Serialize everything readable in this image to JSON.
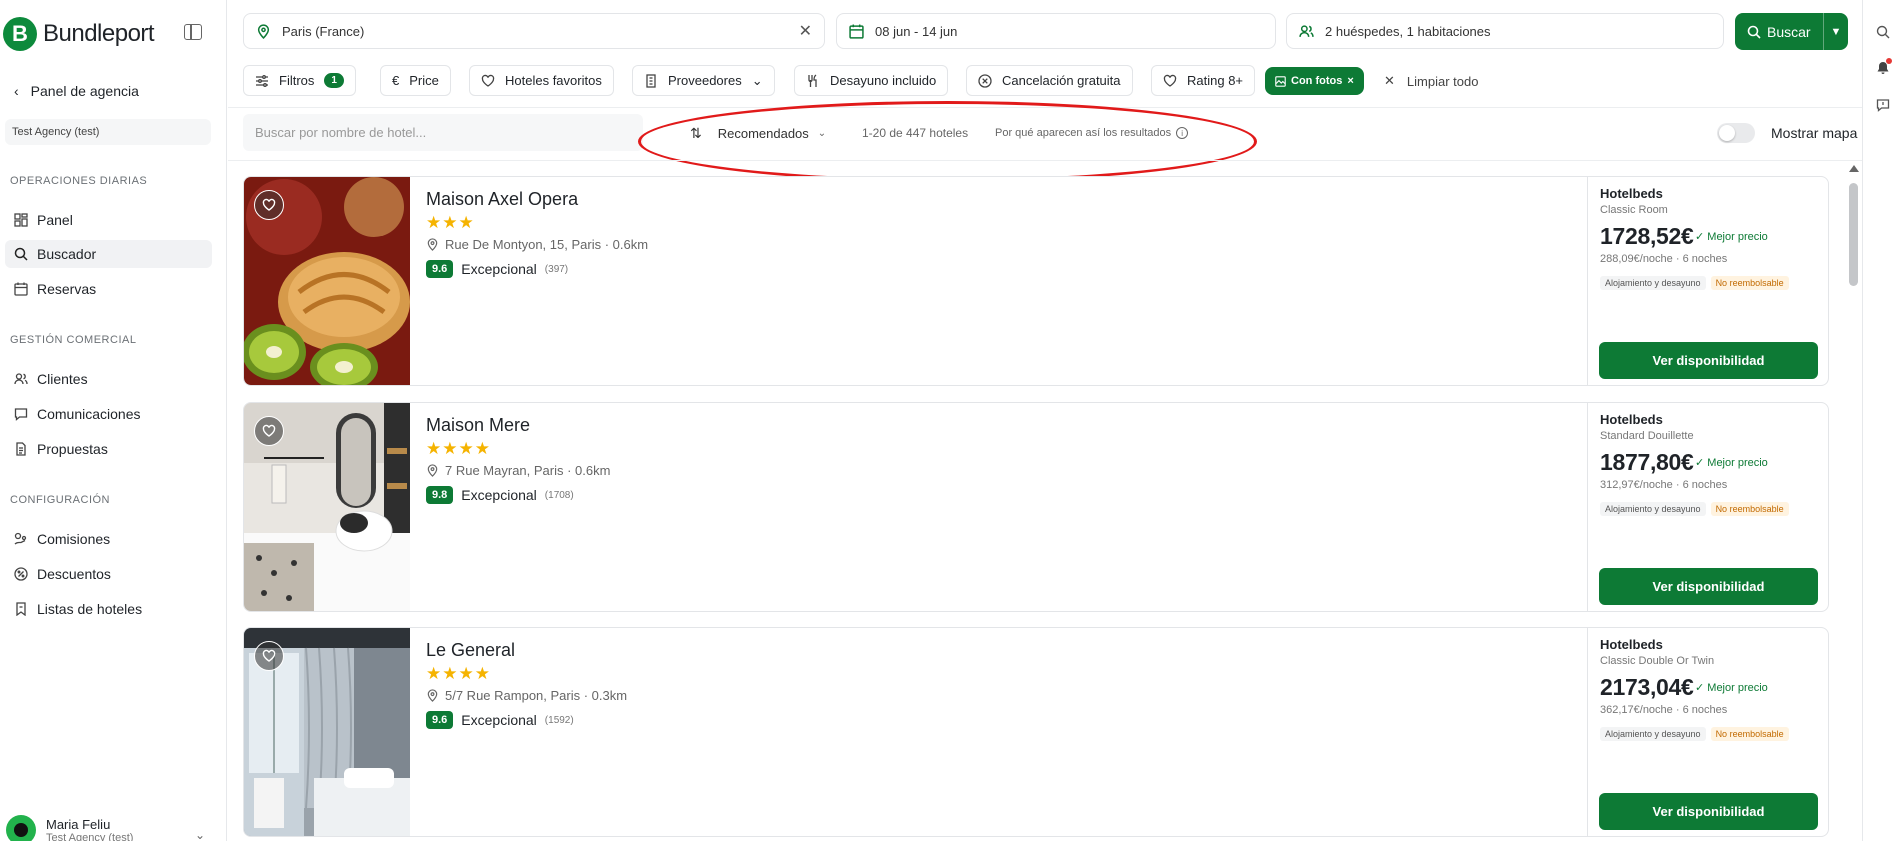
{
  "brand": {
    "logo_letter": "B",
    "name": "Bundleport",
    "accent": "#0d7a35"
  },
  "sidebar": {
    "back_label": "Panel de agencia",
    "agency": "Test Agency (test)",
    "sections": [
      {
        "title": "OPERACIONES DIARIAS",
        "items": [
          {
            "label": "Panel",
            "icon": "dashboard-icon"
          },
          {
            "label": "Buscador",
            "icon": "search-icon",
            "active": true
          },
          {
            "label": "Reservas",
            "icon": "calendar-icon"
          }
        ]
      },
      {
        "title": "GESTIÓN COMERCIAL",
        "items": [
          {
            "label": "Clientes",
            "icon": "users-icon"
          },
          {
            "label": "Comunicaciones",
            "icon": "chat-icon"
          },
          {
            "label": "Propuestas",
            "icon": "document-icon"
          }
        ]
      },
      {
        "title": "CONFIGURACIÓN",
        "items": [
          {
            "label": "Comisiones",
            "icon": "commission-icon"
          },
          {
            "label": "Descuentos",
            "icon": "discount-icon"
          },
          {
            "label": "Listas de hoteles",
            "icon": "bookmark-list-icon"
          }
        ]
      }
    ],
    "user": {
      "name": "Maria Feliu",
      "sub": "Test Agency (test)"
    }
  },
  "search": {
    "destination": "Paris (France)",
    "dates": "08 jun - 14 jun",
    "guests": "2 huéspedes, 1 habitaciones",
    "button": "Buscar"
  },
  "filters": {
    "filtros_label": "Filtros",
    "filtros_count": "1",
    "chips": [
      "Price",
      "Hoteles favoritos",
      "Proveedores",
      "Desayuno incluido",
      "Cancelación gratuita",
      "Rating 8+"
    ],
    "active_chip": "Con fotos",
    "clear_all": "Limpiar todo"
  },
  "results": {
    "search_placeholder": "Buscar por nombre de hotel...",
    "sort_label": "Recomendados",
    "count": "1-20 de 447 hoteles",
    "why": "Por qué aparecen así los resultados",
    "map_label": "Mostrar mapa"
  },
  "hotels": [
    {
      "name": "Maison Axel Opera",
      "stars": "★★★",
      "address": "Rue De Montyon, 15, Paris · 0.6km",
      "score": "9.6",
      "score_label": "Excepcional",
      "reviews": "(397)",
      "provider": "Hotelbeds",
      "room": "Classic Room",
      "price": "1728,52€",
      "best": "Mejor precio",
      "per_night": "288,09€/noche · 6 noches",
      "board": "Alojamiento y desayuno",
      "refund": "No reembolsable",
      "cta": "Ver disponibilidad"
    },
    {
      "name": "Maison Mere",
      "stars": "★★★★",
      "address": "7 Rue Mayran, Paris · 0.6km",
      "score": "9.8",
      "score_label": "Excepcional",
      "reviews": "(1708)",
      "provider": "Hotelbeds",
      "room": "Standard Douillette",
      "price": "1877,80€",
      "best": "Mejor precio",
      "per_night": "312,97€/noche · 6 noches",
      "board": "Alojamiento y desayuno",
      "refund": "No reembolsable",
      "cta": "Ver disponibilidad"
    },
    {
      "name": "Le General",
      "stars": "★★★★",
      "address": "5/7 Rue Rampon, Paris · 0.3km",
      "score": "9.6",
      "score_label": "Excepcional",
      "reviews": "(1592)",
      "provider": "Hotelbeds",
      "room": "Classic Double Or Twin",
      "price": "2173,04€",
      "best": "Mejor precio",
      "per_night": "362,17€/noche · 6 noches",
      "board": "Alojamiento y desayuno",
      "refund": "No reembolsable",
      "cta": "Ver disponibilidad"
    }
  ]
}
